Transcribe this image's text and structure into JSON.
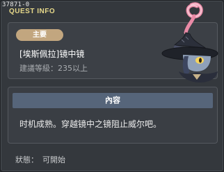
{
  "window": {
    "id": "37871-0",
    "title": "QUEST INFO"
  },
  "quest": {
    "category": "主要",
    "name": "[埃斯佩拉]镜中镜",
    "level_requirement": "建議等級：235以上"
  },
  "content": {
    "header": "內容",
    "text": "时机成熟。穿越镜中之镜阻止威尔吧。"
  },
  "status": {
    "label": "狀態：",
    "value": "可開始"
  },
  "colors": {
    "title": "#e7d98a",
    "badge": "#c2a67f",
    "content_header": "#56657a",
    "panel": "#3c4046"
  }
}
